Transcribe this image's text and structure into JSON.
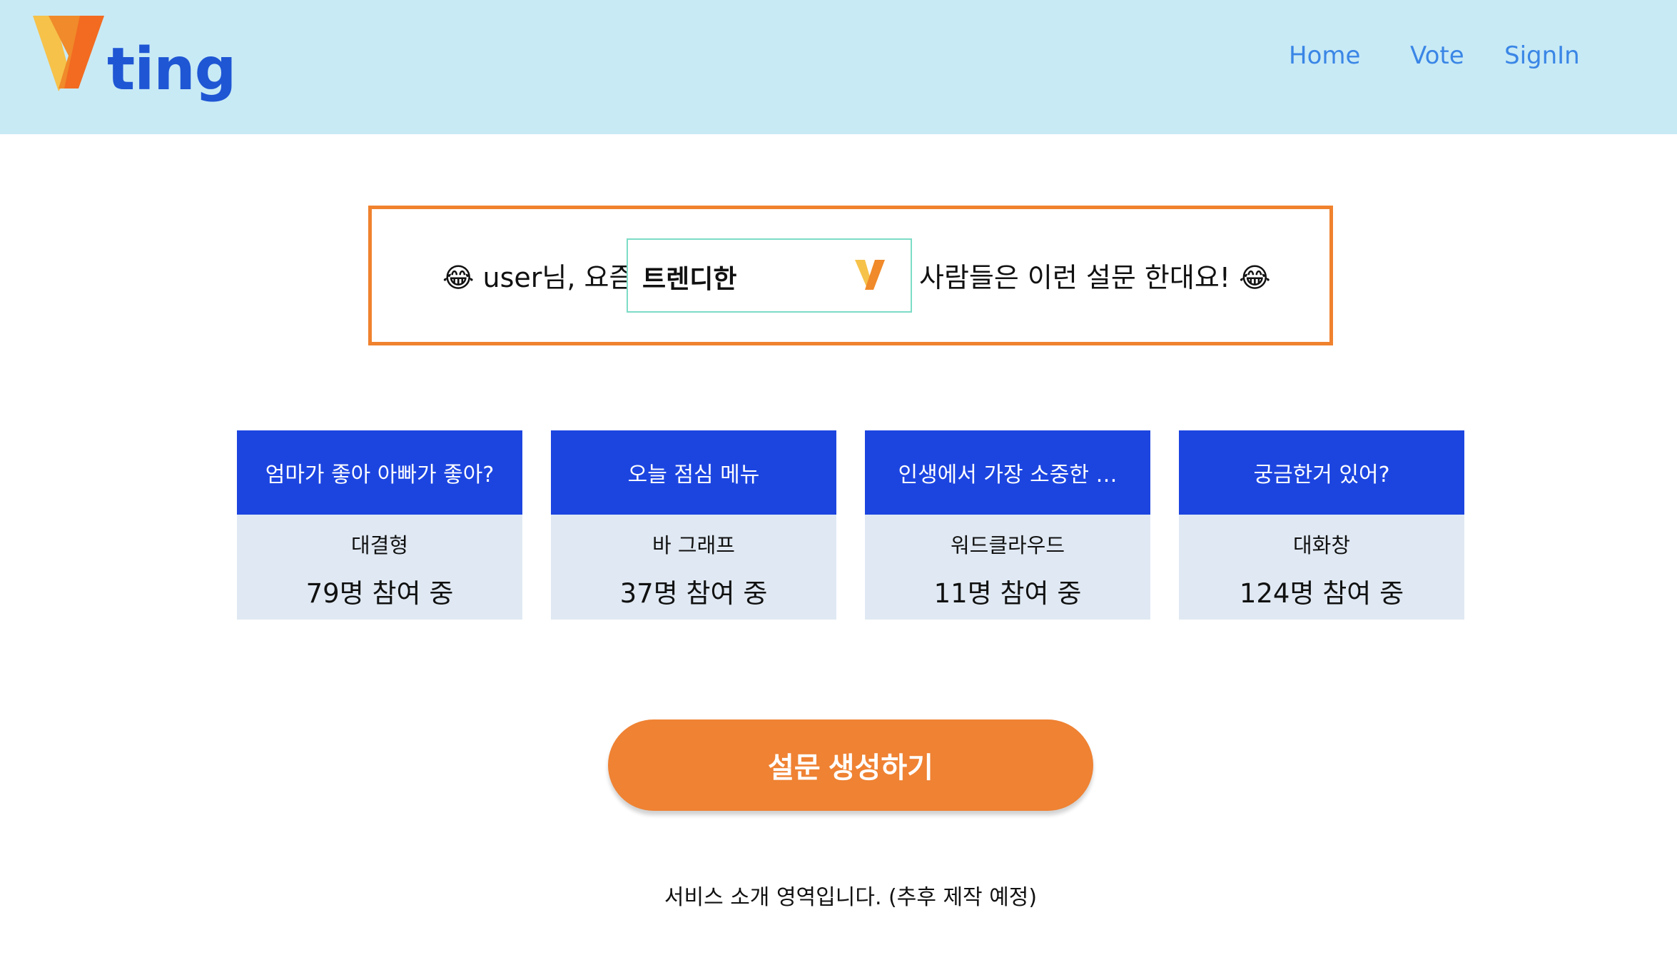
{
  "header": {
    "logo_text": "ting",
    "nav": {
      "home": "Home",
      "vote": "Vote",
      "signin": "SignIn"
    }
  },
  "prompt": {
    "prefix": "😂 user님, 요즘",
    "select_value": "트렌디한",
    "suffix": "사람들은 이런 설문 한대요! 😂"
  },
  "cards": [
    {
      "title": "엄마가 좋아 아빠가 좋아?",
      "type": "대결형",
      "count": "79명 참여 중"
    },
    {
      "title": "오늘 점심 메뉴",
      "type": "바 그래프",
      "count": "37명 참여 중"
    },
    {
      "title": "인생에서 가장 소중한 …",
      "type": "워드클라우드",
      "count": "11명 참여 중"
    },
    {
      "title": "궁금한거 있어?",
      "type": "대화창",
      "count": "124명 참여 중"
    }
  ],
  "create_button": "설문 생성하기",
  "footer": "서비스 소개 영역입니다. (추후 제작 예정)",
  "colors": {
    "header_bg": "#c8eaf5",
    "accent_orange": "#ef8233",
    "card_blue": "#1c45e0",
    "card_body": "#e0e9f3",
    "nav_blue": "#3a86e6"
  }
}
